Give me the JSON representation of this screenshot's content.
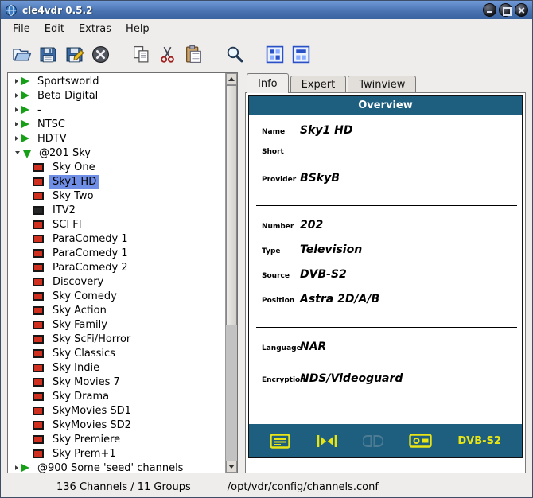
{
  "window": {
    "title": "cle4vdr 0.5.2",
    "buttons": [
      "minimize",
      "maximize",
      "close"
    ]
  },
  "colors": {
    "titlebar_blue": "#4a74b2",
    "panel_teal": "#1e5f80",
    "icon_yellow": "#e8e416",
    "icon_disabled": "#4d7b94",
    "selection_blue": "#6f8ee6",
    "channel_red": "#d03020"
  },
  "menu": {
    "items": [
      "File",
      "Edit",
      "Extras",
      "Help"
    ]
  },
  "toolbar": {
    "buttons": [
      {
        "name": "open-file",
        "gap": false
      },
      {
        "name": "save",
        "gap": false
      },
      {
        "name": "save-as",
        "gap": false
      },
      {
        "name": "close-file",
        "gap": false
      },
      {
        "name": "copy",
        "gap": true
      },
      {
        "name": "cut",
        "gap": false
      },
      {
        "name": "paste",
        "gap": false
      },
      {
        "name": "find",
        "gap": true
      },
      {
        "name": "expand-groups",
        "gap": true
      },
      {
        "name": "expand-channels",
        "gap": false
      }
    ]
  },
  "tree": {
    "items": [
      {
        "label": "Sportsworld",
        "type": "group",
        "expanded": false
      },
      {
        "label": "Beta Digital",
        "type": "group",
        "expanded": false
      },
      {
        "label": "-",
        "type": "group",
        "expanded": false
      },
      {
        "label": "NTSC",
        "type": "group",
        "expanded": false
      },
      {
        "label": "HDTV",
        "type": "group",
        "expanded": false
      },
      {
        "label": "@201 Sky",
        "type": "group",
        "expanded": true
      },
      {
        "label": "Sky One",
        "type": "channel",
        "icon": "red"
      },
      {
        "label": "Sky1 HD",
        "type": "channel",
        "icon": "red",
        "selected": true
      },
      {
        "label": "Sky Two",
        "type": "channel",
        "icon": "red"
      },
      {
        "label": "ITV2",
        "type": "channel",
        "icon": "black"
      },
      {
        "label": "SCI FI",
        "type": "channel",
        "icon": "red"
      },
      {
        "label": "ParaComedy 1",
        "type": "channel",
        "icon": "red"
      },
      {
        "label": "ParaComedy 1",
        "type": "channel",
        "icon": "red"
      },
      {
        "label": "ParaComedy 2",
        "type": "channel",
        "icon": "red"
      },
      {
        "label": "Discovery",
        "type": "channel",
        "icon": "red"
      },
      {
        "label": "Sky Comedy",
        "type": "channel",
        "icon": "red"
      },
      {
        "label": "Sky Action",
        "type": "channel",
        "icon": "red"
      },
      {
        "label": "Sky Family",
        "type": "channel",
        "icon": "red"
      },
      {
        "label": "Sky ScFi/Horror",
        "type": "channel",
        "icon": "red"
      },
      {
        "label": "Sky Classics",
        "type": "channel",
        "icon": "red"
      },
      {
        "label": "Sky Indie",
        "type": "channel",
        "icon": "red"
      },
      {
        "label": "Sky Movies 7",
        "type": "channel",
        "icon": "red"
      },
      {
        "label": "Sky Drama",
        "type": "channel",
        "icon": "red"
      },
      {
        "label": "SkyMovies SD1",
        "type": "channel",
        "icon": "red"
      },
      {
        "label": "SkyMovies SD2",
        "type": "channel",
        "icon": "red"
      },
      {
        "label": "Sky Premiere",
        "type": "channel",
        "icon": "red"
      },
      {
        "label": "Sky Prem+1",
        "type": "channel",
        "icon": "red"
      },
      {
        "label": "@900 Some 'seed' channels",
        "type": "group",
        "expanded": false
      }
    ]
  },
  "tabs": [
    {
      "label": "Info",
      "active": true
    },
    {
      "label": "Expert",
      "active": false
    },
    {
      "label": "Twinview",
      "active": false
    }
  ],
  "overview": {
    "title": "Overview",
    "groups": [
      {
        "fields": [
          {
            "label": "Name",
            "value": "Sky1 HD"
          },
          {
            "label": "Short",
            "value": ""
          },
          {
            "label": "Provider",
            "value": "BSkyB"
          }
        ]
      },
      {
        "fields": [
          {
            "label": "Number",
            "value": "202"
          },
          {
            "label": "Type",
            "value": "Television"
          },
          {
            "label": "Source",
            "value": "DVB-S2"
          },
          {
            "label": "Position",
            "value": "Astra 2D/A/B"
          }
        ]
      },
      {
        "fields": [
          {
            "label": "Language",
            "value": "NAR"
          },
          {
            "label": "Encryption",
            "value": "NDS/Videoguard"
          }
        ]
      }
    ],
    "footer_icons": [
      {
        "name": "teletext",
        "enabled": true
      },
      {
        "name": "widescreen",
        "enabled": true
      },
      {
        "name": "dolby",
        "enabled": false
      },
      {
        "name": "vcr",
        "enabled": true
      }
    ],
    "footer_label": "DVB-S2"
  },
  "statusbar": {
    "channels": "136 Channels / 11 Groups",
    "path": "/opt/vdr/config/channels.conf"
  }
}
